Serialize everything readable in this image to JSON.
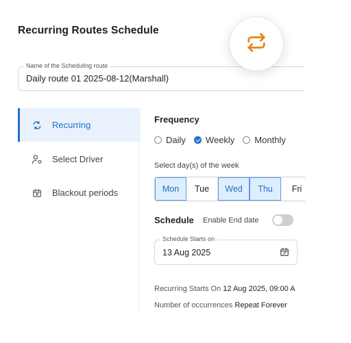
{
  "title": "Recurring Routes Schedule",
  "route_field": {
    "label": "Name of the Scheduling route",
    "value": "Daily route 01  2025-08-12(Marshall)"
  },
  "sidebar": {
    "items": [
      {
        "label": "Recurring",
        "icon": "repeat-icon",
        "active": true
      },
      {
        "label": "Select Driver",
        "icon": "user-settings-icon",
        "active": false
      },
      {
        "label": "Blackout periods",
        "icon": "calendar-x-icon",
        "active": false
      }
    ]
  },
  "frequency": {
    "label": "Frequency",
    "options": [
      "Daily",
      "Weekly",
      "Monthly"
    ],
    "selected": "Weekly"
  },
  "days": {
    "label": "Select day(s) of the week",
    "items": [
      "Mon",
      "Tue",
      "Wed",
      "Thu",
      "Fri"
    ],
    "selected": [
      "Mon",
      "Wed",
      "Thu"
    ]
  },
  "schedule": {
    "label": "Schedule",
    "enable_end_label": "Enable End date",
    "enable_end": false
  },
  "start_field": {
    "label": "Schedule Starts on",
    "value": "13 Aug 2025"
  },
  "info": {
    "recurring_label": "Recurring Starts On",
    "recurring_value": "12 Aug 2025, 09:00 A",
    "occurrences_label": "Number of occurrences",
    "occurrences_value": "Repeat Forever"
  },
  "colors": {
    "accent": "#1f6fc4",
    "fab_icon": "#e8861a"
  }
}
